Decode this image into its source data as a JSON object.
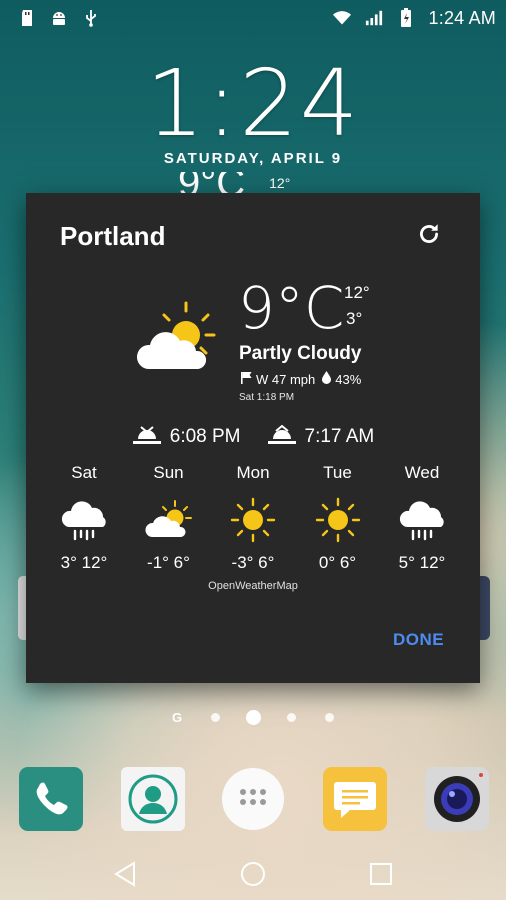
{
  "statusbar": {
    "left_icons": [
      "sd-card-icon",
      "android-icon",
      "usb-icon"
    ],
    "right_icons": [
      "wifi-icon",
      "signal-icon",
      "battery-charging-icon"
    ],
    "time": "1:24 AM"
  },
  "lockscreen": {
    "time": "1:24",
    "date": "SATURDAY, APRIL 9",
    "weather_temp": "9°C",
    "weather_hi": "12°"
  },
  "dialog": {
    "city": "Portland",
    "current": {
      "temp": "9°C",
      "hi": "12°",
      "lo": "3°",
      "condition": "Partly Cloudy",
      "wind": "W 47 mph",
      "humidity": "43%",
      "updated": "Sat 1:18 PM",
      "icon": "partly-cloudy-icon"
    },
    "sunset": "6:08 PM",
    "sunrise": "7:17 AM",
    "forecast": [
      {
        "day": "Sat",
        "temps": "3° 12°",
        "icon": "rain-icon"
      },
      {
        "day": "Sun",
        "temps": "-1° 6°",
        "icon": "partly-cloudy-icon"
      },
      {
        "day": "Mon",
        "temps": "-3° 6°",
        "icon": "sun-icon"
      },
      {
        "day": "Tue",
        "temps": "0° 6°",
        "icon": "sun-icon"
      },
      {
        "day": "Wed",
        "temps": "5° 12°",
        "icon": "rain-icon"
      }
    ],
    "provider": "OpenWeatherMap",
    "done_label": "DONE"
  },
  "pager": {
    "google_label": "G",
    "page_count": 4,
    "active_index": 1
  },
  "dock": {
    "apps": [
      "phone-icon",
      "contacts-icon",
      "app-drawer-icon",
      "messaging-icon",
      "camera-icon"
    ]
  },
  "navbar": {
    "buttons": [
      "back-icon",
      "home-icon",
      "recents-icon"
    ]
  },
  "colors": {
    "dialog_bg": "#282828",
    "accent": "#4e8bf0",
    "sun_yellow": "#f5c518",
    "phone_green": "#2a8f80",
    "messaging_yellow": "#f6c13d"
  }
}
